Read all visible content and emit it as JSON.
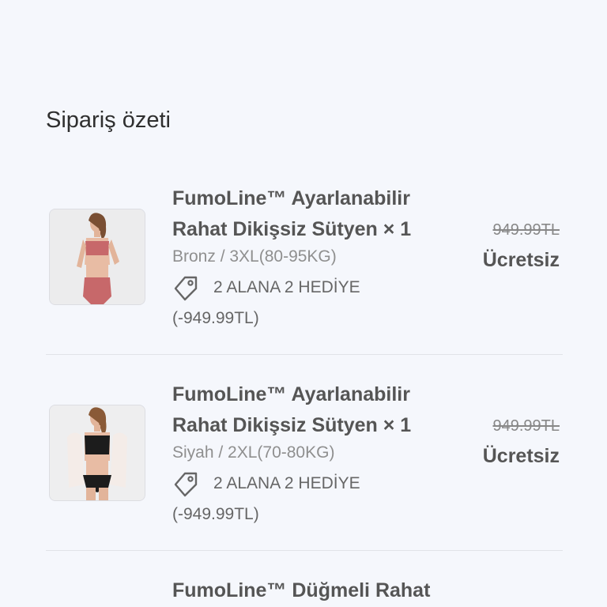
{
  "summary": {
    "title": "Sipariş özeti"
  },
  "items": [
    {
      "name_line1": "FumoLine™ Ayarlanabilir",
      "name_line2": "Rahat Dikişsiz Sütyen × 1",
      "variant": "Bronz / 3XL(80-95KG)",
      "promo": "2 ALANA 2 HEDİYE",
      "discount": "(-949.99TL)",
      "old_price": "949.99TL",
      "new_price": "Ücretsiz",
      "image_color": "#c7686a"
    },
    {
      "name_line1": "FumoLine™ Ayarlanabilir",
      "name_line2": "Rahat Dikişsiz Sütyen × 1",
      "variant": "Siyah / 2XL(70-80KG)",
      "promo": "2 ALANA 2 HEDİYE",
      "discount": "(-949.99TL)",
      "old_price": "949.99TL",
      "new_price": "Ücretsiz",
      "image_color": "#1c1c1c"
    },
    {
      "name_line1": "FumoLine™ Düğmeli Rahat"
    }
  ]
}
